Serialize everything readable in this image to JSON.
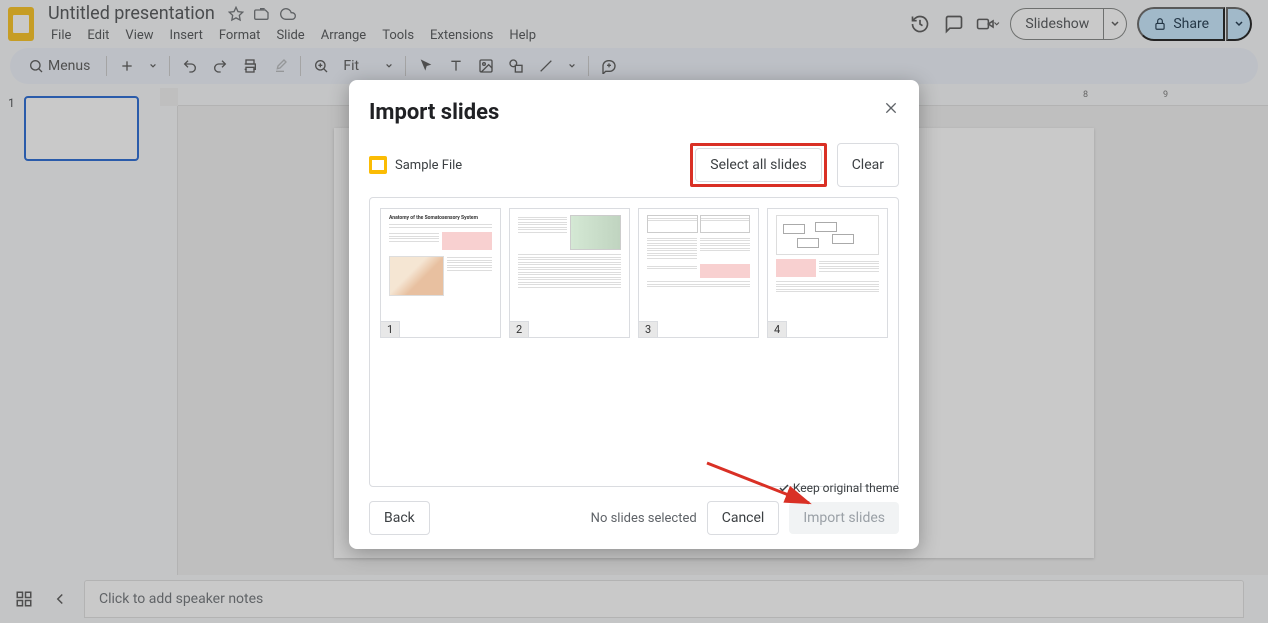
{
  "header": {
    "doc_title": "Untitled presentation",
    "menus": [
      "File",
      "Edit",
      "View",
      "Insert",
      "Format",
      "Slide",
      "Arrange",
      "Tools",
      "Extensions",
      "Help"
    ],
    "slideshow_label": "Slideshow",
    "share_label": "Share"
  },
  "toolbar": {
    "menus_label": "Menus",
    "zoom_label": "Fit"
  },
  "sidebar": {
    "slide_number": "1"
  },
  "speaker_notes_placeholder": "Click to add speaker notes",
  "modal": {
    "title": "Import slides",
    "file_name": "Sample File",
    "select_all_label": "Select all slides",
    "clear_label": "Clear",
    "slide_numbers": [
      "1",
      "2",
      "3",
      "4"
    ],
    "slide1_heading": "Anatomy of the Somatosensory System",
    "keep_theme_label": "Keep original theme",
    "status_text": "No slides selected",
    "back_label": "Back",
    "cancel_label": "Cancel",
    "import_label": "Import slides"
  },
  "ruler_marks": [
    "8",
    "9"
  ]
}
